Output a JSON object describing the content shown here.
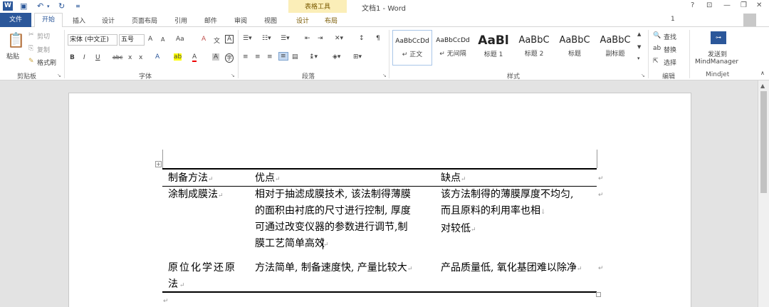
{
  "title_bar": {
    "doc_title": "文档1 - Word",
    "contextual_group": "表格工具",
    "win_help": "?",
    "win_ribbon": "⊡",
    "win_min": "—",
    "win_restore": "❐",
    "win_close": "✕"
  },
  "tabs": {
    "file": "文件",
    "home": "开始",
    "insert": "插入",
    "design": "设计",
    "page_layout": "页面布局",
    "references": "引用",
    "mailings": "邮件",
    "review": "审阅",
    "view": "视图",
    "table_design": "设计",
    "table_layout": "布局",
    "user_name": "1"
  },
  "clipboard": {
    "paste": "粘贴",
    "cut": "剪切",
    "copy": "复制",
    "format_painter": "格式刷",
    "label": "剪贴板"
  },
  "font": {
    "font_name": "宋体 (中文正)",
    "font_size": "五号",
    "grow": "A",
    "shrink": "A",
    "case": "Aa",
    "clear": "A",
    "pinyin": "文",
    "border": "A",
    "bold": "B",
    "italic": "I",
    "underline": "U",
    "strike": "abc",
    "subscript": "x",
    "superscript": "x",
    "text_effects": "A",
    "highlight": "ab",
    "font_color": "A",
    "char_shading": "A",
    "enclose": "字",
    "label": "字体"
  },
  "paragraph": {
    "label": "段落"
  },
  "styles": {
    "label": "样式",
    "items": [
      {
        "sample": "AaBbCcDd",
        "name": "↵ 正文"
      },
      {
        "sample": "AaBbCcDd",
        "name": "↵ 无间隔"
      },
      {
        "sample": "AaBl",
        "name": "标题 1"
      },
      {
        "sample": "AaBbC",
        "name": "标题 2"
      },
      {
        "sample": "AaBbC",
        "name": "标题"
      },
      {
        "sample": "AaBbC",
        "name": "副标题"
      }
    ]
  },
  "editing": {
    "find": "查找",
    "replace": "替换",
    "select": "选择",
    "label": "编辑"
  },
  "mindjet": {
    "send_line1": "发送到",
    "send_line2": "MindManager",
    "label": "Mindjet"
  },
  "table": {
    "headers": [
      "制备方法",
      "优点",
      "缺点"
    ],
    "rows": [
      {
        "method": [
          "涂制成膜法"
        ],
        "advantages": [
          "相对于抽滤成膜技术, 该法制得薄膜",
          "的面积由衬底的尺寸进行控制, 厚度",
          "可通过改变仪器的参数进行调节,制",
          "膜工艺简单高效"
        ],
        "disadvantages": [
          "该方法制得的薄膜厚度不均匀,",
          "而且原料的利用率也相",
          "对较低"
        ]
      },
      {
        "method": [
          "原位化学还原",
          "法"
        ],
        "advantages": [
          "方法简单, 制备速度快, 产量比较大"
        ],
        "disadvantages": [
          "产品质量低, 氧化基团难以除净"
        ]
      }
    ]
  },
  "colors": {
    "accent": "#2b579a",
    "contextual": "#fbeeb8"
  }
}
